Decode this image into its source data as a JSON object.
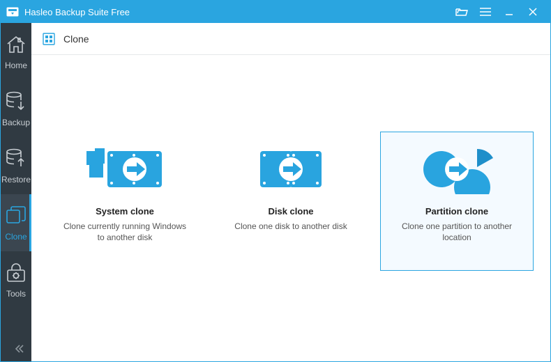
{
  "titlebar": {
    "title": "Hasleo Backup Suite Free"
  },
  "colors": {
    "accent": "#2aa5e0",
    "sidebar_bg": "#303a42",
    "sidebar_active_bg": "#3b4650"
  },
  "sidebar": {
    "active_index": 3,
    "items": [
      {
        "id": "home",
        "label": "Home"
      },
      {
        "id": "backup",
        "label": "Backup"
      },
      {
        "id": "restore",
        "label": "Restore"
      },
      {
        "id": "clone",
        "label": "Clone"
      },
      {
        "id": "tools",
        "label": "Tools"
      }
    ]
  },
  "main": {
    "page_title": "Clone",
    "hovered_card_index": 2,
    "cards": [
      {
        "id": "system-clone",
        "title": "System clone",
        "desc": "Clone currently running Windows to another disk"
      },
      {
        "id": "disk-clone",
        "title": "Disk clone",
        "desc": "Clone one disk to another disk"
      },
      {
        "id": "partition-clone",
        "title": "Partition clone",
        "desc": "Clone one partition to another location"
      }
    ]
  }
}
